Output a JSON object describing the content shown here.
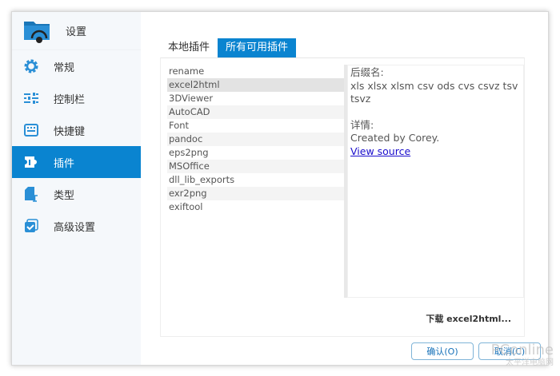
{
  "window": {
    "title": "设置"
  },
  "sidebar": {
    "items": [
      {
        "label": "常规",
        "icon": "gear-icon"
      },
      {
        "label": "控制栏",
        "icon": "sliders-icon"
      },
      {
        "label": "快捷键",
        "icon": "keyboard-icon"
      },
      {
        "label": "插件",
        "icon": "puzzle-icon",
        "active": true
      },
      {
        "label": "类型",
        "icon": "file-type-icon"
      },
      {
        "label": "高级设置",
        "icon": "checkbox-icon"
      }
    ]
  },
  "tabs": [
    {
      "label": "本地插件"
    },
    {
      "label": "所有可用插件",
      "active": true
    }
  ],
  "plugins": [
    "rename",
    "excel2html",
    "3DViewer",
    "AutoCAD",
    "Font",
    "pandoc",
    "eps2png",
    "MSOffice",
    "dll_lib_exports",
    "exr2png",
    "exiftool"
  ],
  "selected": "excel2html",
  "detail": {
    "ext_label": "后缀名:",
    "ext_value": "xls xlsx xlsm csv ods cvs csvz tsv tsvz",
    "info_label": "详情:",
    "info_value": "Created by Corey.",
    "link": "View source"
  },
  "download_label": "下载 excel2html...",
  "buttons": {
    "ok": "确认(O)",
    "cancel": "取消(C)"
  },
  "watermark": {
    "brand": "PConline",
    "sub": "太平洋电脑网"
  },
  "colors": {
    "accent": "#0a84d0"
  }
}
